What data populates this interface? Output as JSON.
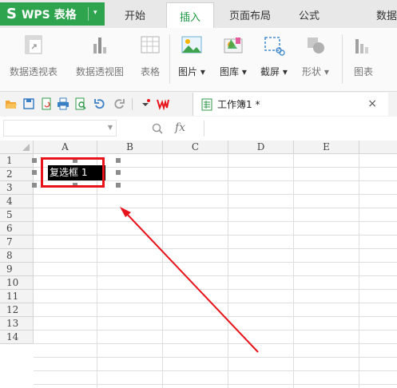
{
  "app": {
    "title": "WPS 表格",
    "logo_glyph": "S",
    "menu_caret": "▾",
    "brand_color": "#2fa44f"
  },
  "tabs": [
    {
      "label": "开始",
      "active": false
    },
    {
      "label": "插入",
      "active": true
    },
    {
      "label": "页面布局",
      "active": false
    },
    {
      "label": "公式",
      "active": false
    },
    {
      "label": "数据",
      "active": false
    }
  ],
  "ribbon": {
    "items": [
      {
        "label": "数据透视表",
        "icon": "pivot-table-icon",
        "enabled": false
      },
      {
        "label": "数据透视图",
        "icon": "pivot-chart-icon",
        "enabled": false
      },
      {
        "label": "表格",
        "icon": "table-icon",
        "enabled": false
      },
      {
        "label": "图片 ▾",
        "icon": "picture-icon",
        "enabled": true
      },
      {
        "label": "图库 ▾",
        "icon": "gallery-icon",
        "enabled": true
      },
      {
        "label": "截屏 ▾",
        "icon": "screenshot-icon",
        "enabled": true
      },
      {
        "label": "形状 ▾",
        "icon": "shapes-icon",
        "enabled": false
      },
      {
        "label": "图表",
        "icon": "chart-icon",
        "enabled": false
      }
    ]
  },
  "quick_access": {
    "icons": [
      "open-icon",
      "save-icon",
      "export-pdf-icon",
      "print-icon",
      "print-preview-icon",
      "undo-icon",
      "redo-icon",
      "customize-icon",
      "wps-logo-icon"
    ]
  },
  "document": {
    "tab_name": "工作簿1 *",
    "close_glyph": "×"
  },
  "formula_bar": {
    "fx_label": "fx",
    "name_box_value": "",
    "formula_value": ""
  },
  "grid": {
    "columns": [
      "A",
      "B",
      "C",
      "D",
      "E"
    ],
    "rows": [
      "1",
      "2",
      "3",
      "4",
      "5",
      "6",
      "7",
      "8",
      "9",
      "10",
      "11",
      "12",
      "13",
      "14"
    ]
  },
  "checkbox_control": {
    "label": "复选框 1"
  },
  "annotation": {
    "color": "#e8141c"
  }
}
